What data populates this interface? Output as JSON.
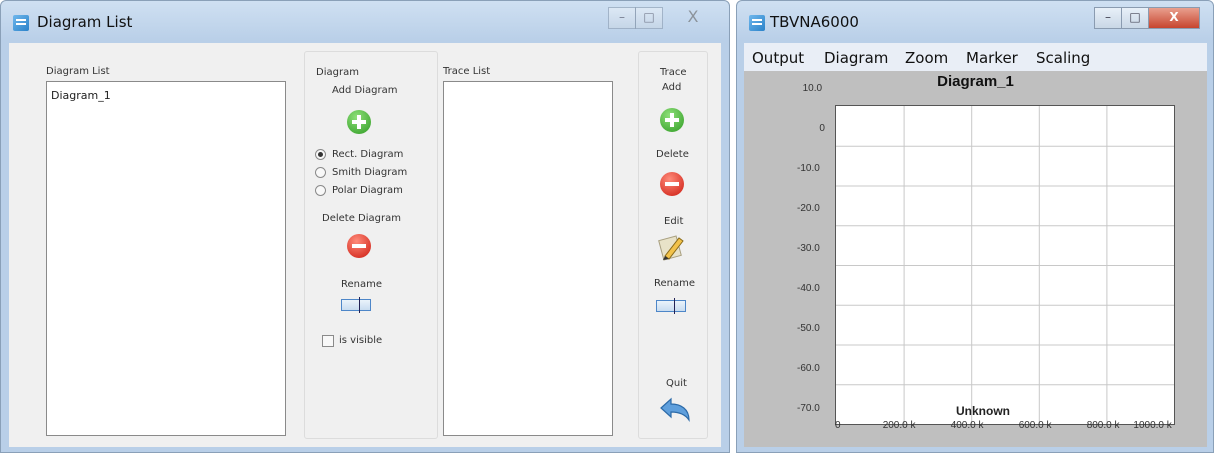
{
  "diagram_list_window": {
    "title": "Diagram List",
    "controls": {
      "minimize": "–",
      "maximize": "□",
      "close": "X"
    },
    "diagram_list": {
      "label": "Diagram List",
      "items": [
        "Diagram_1"
      ]
    },
    "diagram_panel": {
      "label": "Diagram",
      "add_label": "Add Diagram",
      "radio_options": [
        {
          "label": "Rect. Diagram",
          "selected": true
        },
        {
          "label": "Smith Diagram",
          "selected": false
        },
        {
          "label": "Polar Diagram",
          "selected": false
        }
      ],
      "delete_label": "Delete Diagram",
      "rename_label": "Rename",
      "visible_label": "is visible",
      "visible_checked": false
    },
    "trace_list": {
      "label": "Trace List",
      "items": []
    },
    "trace_panel": {
      "label": "Trace",
      "add_label": "Add",
      "delete_label": "Delete",
      "edit_label": "Edit",
      "rename_label": "Rename",
      "quit_label": "Quit"
    }
  },
  "tbvna_window": {
    "title": "TBVNA6000",
    "controls": {
      "minimize": "–",
      "maximize": "□",
      "close": "X"
    },
    "menu": [
      "Output",
      "Diagram",
      "Zoom",
      "Marker",
      "Scaling"
    ]
  },
  "chart_data": {
    "type": "line",
    "title": "Diagram_1",
    "xlabel": "Unknown",
    "ylabel": "",
    "x_tick_labels": [
      "0",
      "200.0 k",
      "400.0 k",
      "600.0 k",
      "800.0 k",
      "1000.0 k"
    ],
    "y_tick_labels": [
      "10.0",
      "0",
      "-10.0",
      "-20.0",
      "-30.0",
      "-40.0",
      "-50.0",
      "-60.0",
      "-70.0"
    ],
    "xlim": [
      0,
      1000000
    ],
    "ylim": [
      -70,
      10
    ],
    "grid": true,
    "series": []
  },
  "colors": {
    "titlebar": "#b9cfe8",
    "client_bg": "#f0f0f0",
    "chart_bg": "#bfbfbf",
    "plot_bg": "#ffffff",
    "add_icon": "#2f9b23",
    "delete_icon": "#cc1a10"
  },
  "icons": {
    "app": "app-icon",
    "add": "plus-circle-icon",
    "delete": "minus-circle-icon",
    "edit": "pencil-icon",
    "rename": "rename-field-icon",
    "quit": "undo-arrow-icon"
  }
}
